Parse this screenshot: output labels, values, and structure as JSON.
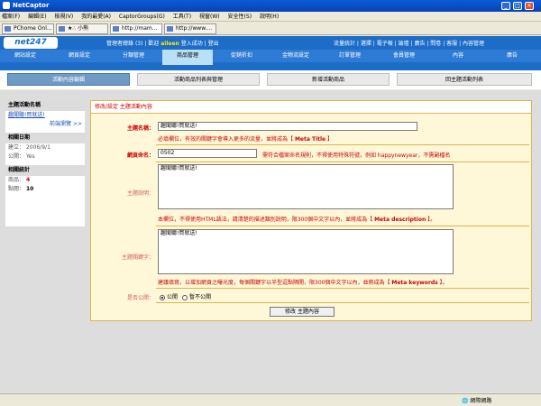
{
  "window": {
    "title": "NetCaptor",
    "min": "_",
    "max": "□",
    "close": "✕"
  },
  "menu": [
    "檔案(F)",
    "編輯(E)",
    "檢視(V)",
    "我的最愛(A)",
    "CaptorGroups(G)",
    "工具(T)",
    "視窗(W)",
    "安全性(S)",
    "說明(H)"
  ],
  "tabs": [
    {
      "label": "PChome Onl..."
    },
    {
      "label": "★∴ 小熊"
    },
    {
      "label": "http://mam..."
    },
    {
      "label": "http://www...."
    }
  ],
  "site": {
    "logo": "net247",
    "admin_area": "管理者總錄",
    "count": "(3)",
    "welcome_prefix": "歡迎",
    "user": "aileen",
    "welcome_suffix": "登入成功",
    "logout": "登出",
    "right_links": [
      "流量統計",
      "選擇",
      "電子報",
      "論壇",
      "廣告",
      "問卷",
      "客服",
      "內容管理"
    ]
  },
  "nav": [
    "網站設定",
    "網頁設定",
    "分類管理",
    "商品管理",
    "促銷折扣",
    "金物流設定",
    "訂單管理",
    "會員管理",
    "內容",
    "廣告"
  ],
  "subtabs": [
    "活動內容編輯",
    "活動商品列表與管理",
    "新增活動商品",
    "回主題活動列表"
  ],
  "sidebar": {
    "name_head": "主題活動名稱",
    "name_link": "趣聞聽!買就送!",
    "preview": "前端瀏覽 >>",
    "date_head": "相關日期",
    "created_label": "建立：",
    "created_value": "2006/9/1",
    "public_label": "公開：",
    "public_value": "Yes",
    "stats_head": "相關統計",
    "goods_label": "商品：",
    "goods_value": "4",
    "clicks_label": "點閱：",
    "clicks_value": "10"
  },
  "form": {
    "header": "修改/設定 主題活動內容",
    "title_label": "主題名稱：",
    "title_value": "趣聞聽!買就送!",
    "title_hint_pre": "必填欄位，有效的關鍵字會導入更多的流量，並將成為",
    "title_hint_tag": "Meta Title",
    "page_label": "網頁命名：",
    "page_value": "0502",
    "page_hint": "需符合檔案命名規則，不得使用特殊符號，例如 happynewyear，不需副檔名",
    "desc_label": "主題說明：",
    "desc_value": "趣聞聽!買就送!",
    "desc_hint_pre": "本欄位，不得使用HTML語法，請清楚的描述類別說明，限300個中文字以內，並將成為",
    "desc_hint_tag": "Meta description",
    "kw_label": "主題關鍵字：",
    "kw_value": "趣聞聽!買就送!",
    "kw_hint_pre": "建議填寫，以增加網頁之曝光度，每個關鍵字以半型逗點隔開，限300個中文字以內，並將成為",
    "kw_hint_tag": "Meta keywords",
    "public_label": "是否公開：",
    "opt_public": "公開",
    "opt_private": "暫不公開",
    "submit": "修改 主題內容"
  },
  "status": {
    "zone": "網際網路"
  }
}
